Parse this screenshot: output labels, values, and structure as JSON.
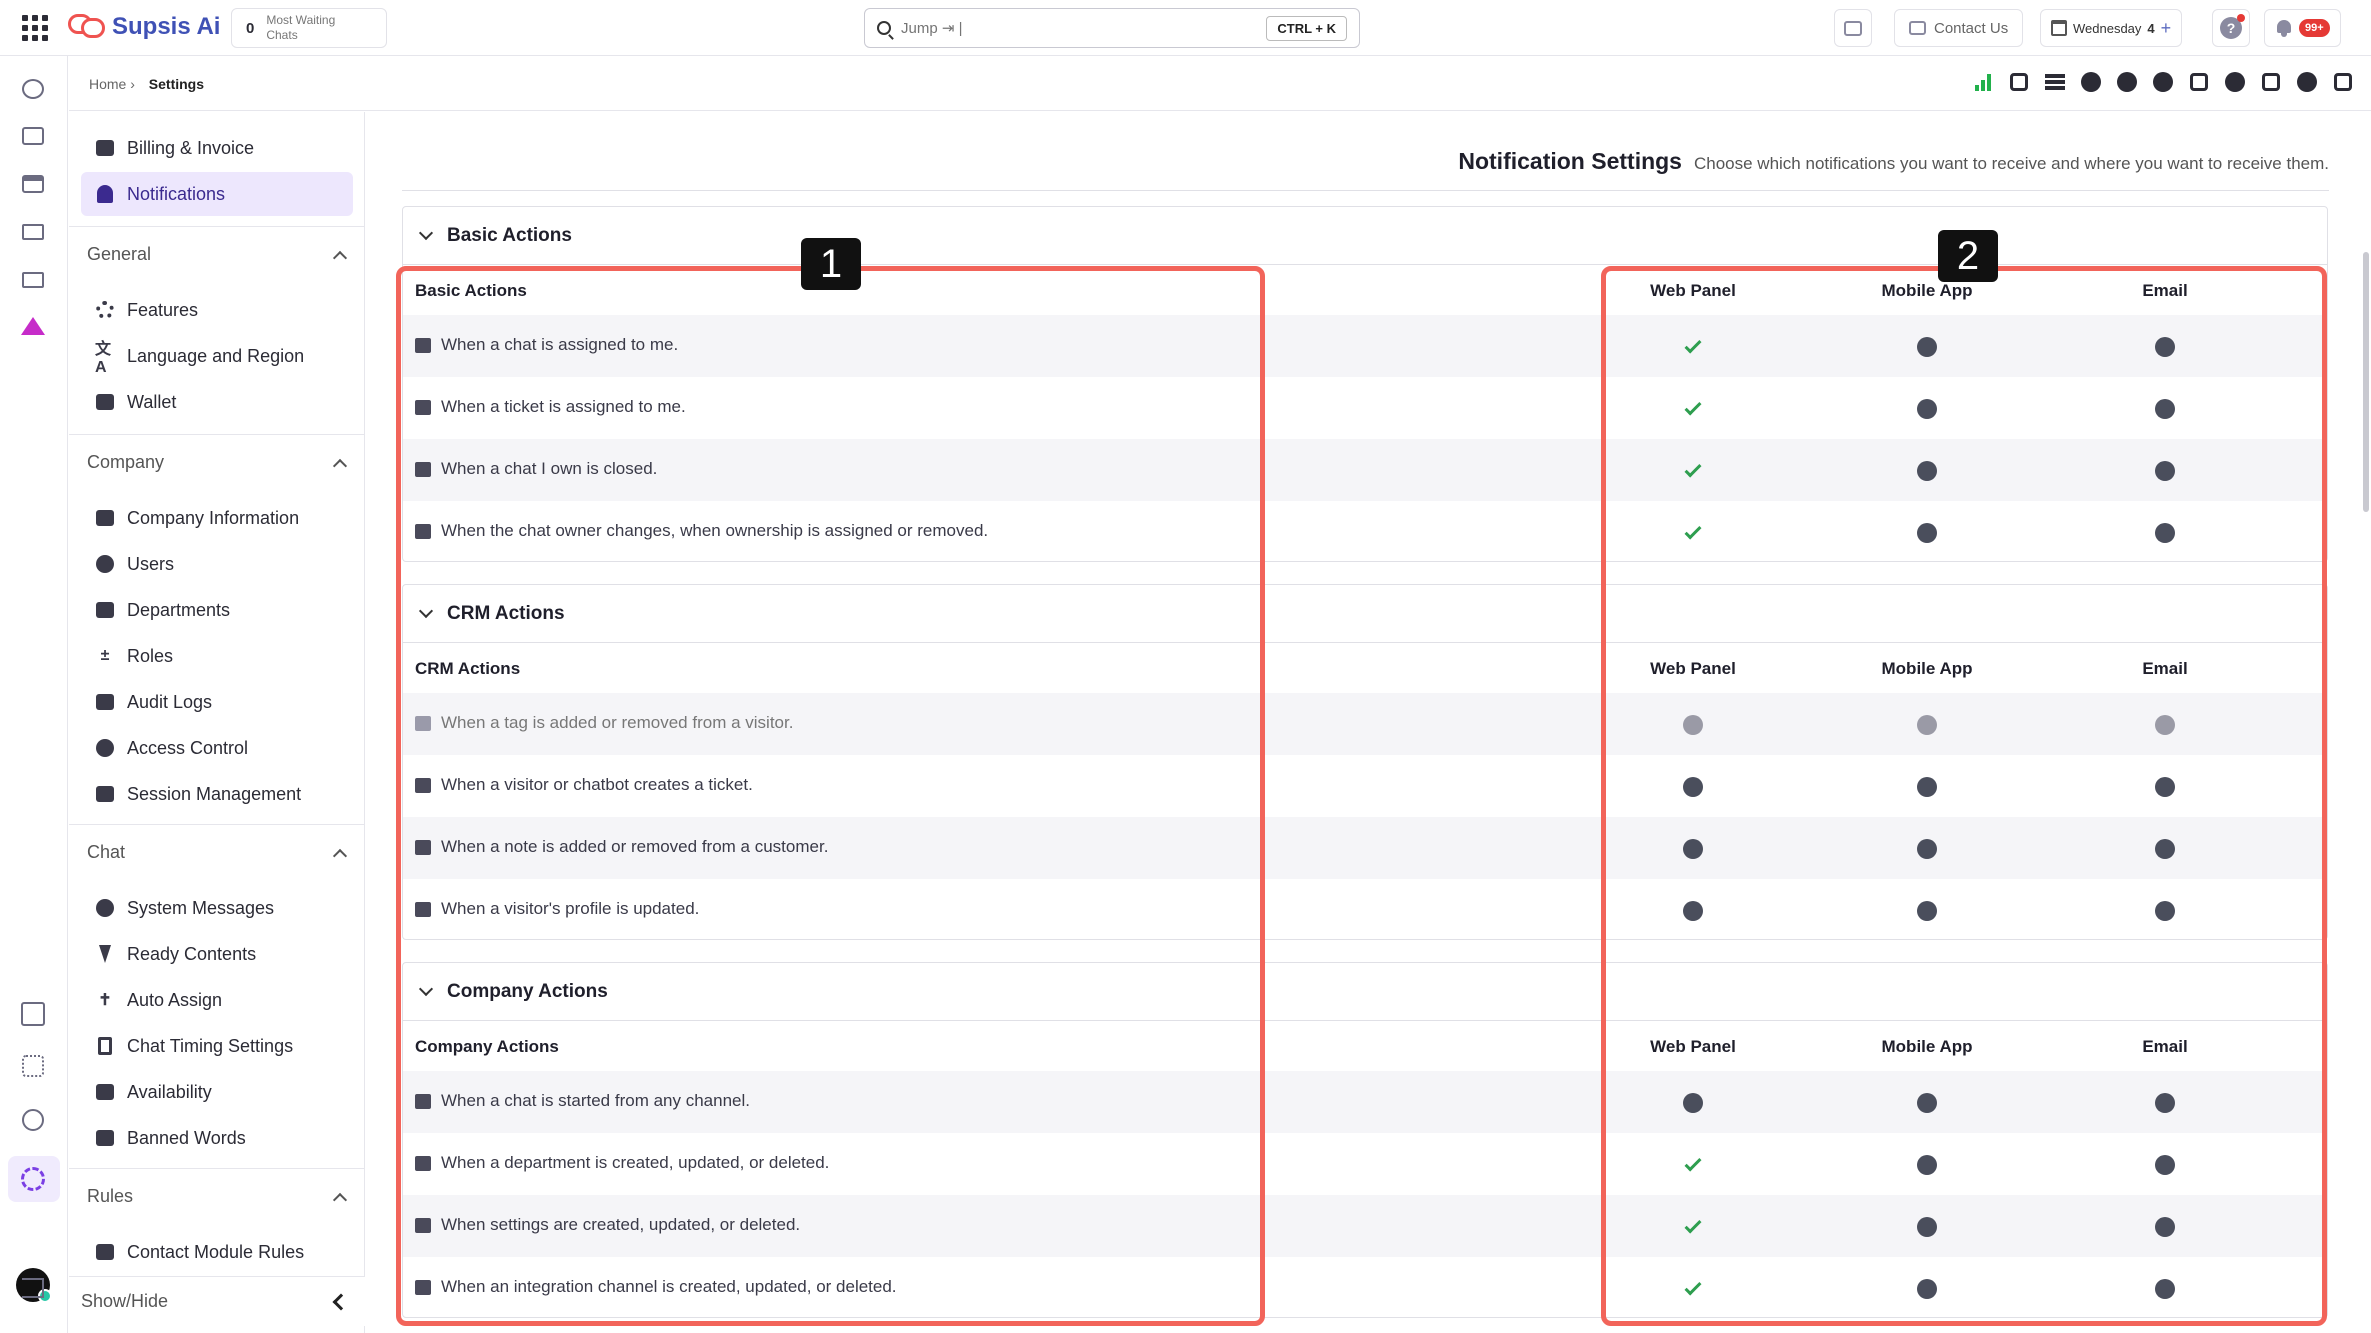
{
  "topbar": {
    "logo": "Supsis Ai",
    "waiting_count": "0",
    "waiting_label": "Most Waiting Chats",
    "search_placeholder": "Jump ⇥ |",
    "search_shortcut": "CTRL + K",
    "contact_us": "Contact Us",
    "date_label": "Wednesday",
    "date_num": "4",
    "help": "?",
    "notif_badge": "99+"
  },
  "breadcrumb": {
    "home": "Home ›",
    "current": "Settings"
  },
  "sidebar": {
    "top_items": [
      {
        "label": "Billing & Invoice",
        "icon": "billing-icon"
      },
      {
        "label": "Notifications",
        "icon": "bell-icon",
        "active": true
      }
    ],
    "sections": [
      {
        "title": "General",
        "items": [
          "Features",
          "Language and Region",
          "Wallet"
        ]
      },
      {
        "title": "Company",
        "items": [
          "Company Information",
          "Users",
          "Departments",
          "Roles",
          "Audit Logs",
          "Access Control",
          "Session Management"
        ]
      },
      {
        "title": "Chat",
        "items": [
          "System Messages",
          "Ready Contents",
          "Auto Assign",
          "Chat Timing Settings",
          "Availability",
          "Banned Words"
        ]
      },
      {
        "title": "Rules",
        "items": [
          "Contact Module Rules"
        ]
      }
    ],
    "show_hide": "Show/Hide"
  },
  "page": {
    "title": "Notification Settings",
    "subtitle": "Choose which notifications you want to receive and where you want to receive them."
  },
  "columns": [
    "Web Panel",
    "Mobile App",
    "Email"
  ],
  "panels": [
    {
      "title": "Basic Actions",
      "header": "Basic Actions",
      "rows": [
        {
          "text": "When a chat is assigned to me.",
          "values": [
            "check",
            "dot",
            "dot"
          ]
        },
        {
          "text": "When a ticket is assigned to me.",
          "values": [
            "check",
            "dot",
            "dot"
          ]
        },
        {
          "text": "When a chat I own is closed.",
          "values": [
            "check",
            "dot",
            "dot"
          ]
        },
        {
          "text": "When the chat owner changes, when ownership is assigned or removed.",
          "values": [
            "check",
            "dot",
            "dot"
          ]
        }
      ]
    },
    {
      "title": "CRM Actions",
      "header": "CRM Actions",
      "rows": [
        {
          "text": "When a tag is added or removed from a visitor.",
          "values": [
            "dim",
            "dim",
            "dim"
          ],
          "dim": true
        },
        {
          "text": "When a visitor or chatbot creates a ticket.",
          "values": [
            "dot",
            "dot",
            "dot"
          ]
        },
        {
          "text": "When a note is added or removed from a customer.",
          "values": [
            "dot",
            "dot",
            "dot"
          ]
        },
        {
          "text": "When a visitor's profile is updated.",
          "values": [
            "dot",
            "dot",
            "dot"
          ]
        }
      ]
    },
    {
      "title": "Company Actions",
      "header": "Company Actions",
      "rows": [
        {
          "text": "When a chat is started from any channel.",
          "values": [
            "dot",
            "dot",
            "dot"
          ]
        },
        {
          "text": "When a department is created, updated, or deleted.",
          "values": [
            "check",
            "dot",
            "dot"
          ]
        },
        {
          "text": "When settings are created, updated, or deleted.",
          "values": [
            "check",
            "dot",
            "dot"
          ]
        },
        {
          "text": "When an integration channel is created, updated, or deleted.",
          "values": [
            "check",
            "dot",
            "dot"
          ]
        }
      ]
    }
  ],
  "annotations": [
    "1",
    "2"
  ],
  "colors": {
    "accent": "#3b2a8f",
    "highlight": "#f2645a",
    "check": "#2e9e4f"
  }
}
